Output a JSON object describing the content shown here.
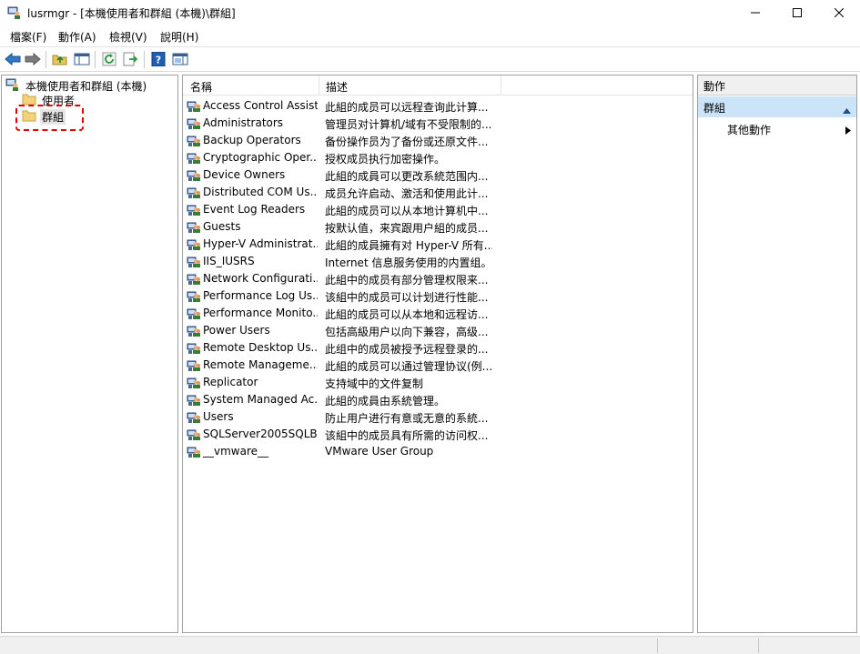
{
  "window": {
    "title": "lusrmgr - [本機使用者和群組 (本機)\\群組]",
    "icon": "computer-users-icon"
  },
  "menu": [
    "檔案(F)",
    "動作(A)",
    "檢視(V)",
    "說明(H)"
  ],
  "toolbar": {
    "buttons": [
      "back-arrow-icon",
      "forward-arrow-icon",
      "up-folder-icon",
      "show-hide-tree-icon",
      "refresh-icon",
      "export-list-icon",
      "help-icon",
      "action-pane-icon"
    ]
  },
  "tree": {
    "root": "本機使用者和群組 (本機)",
    "users": "使用者",
    "groups": "群組"
  },
  "list": {
    "columns": [
      "名稱",
      "描述"
    ],
    "rows": [
      {
        "name": "Access Control Assist...",
        "desc": "此組的成员可以远程查询此计算..."
      },
      {
        "name": "Administrators",
        "desc": "管理员对计算机/域有不受限制的..."
      },
      {
        "name": "Backup Operators",
        "desc": "备份操作员为了备份或还原文件..."
      },
      {
        "name": "Cryptographic Oper...",
        "desc": "授权成员执行加密操作。"
      },
      {
        "name": "Device Owners",
        "desc": "此組的成員可以更改系統范围内..."
      },
      {
        "name": "Distributed COM Us...",
        "desc": "成员允许启动、激活和使用此计..."
      },
      {
        "name": "Event Log Readers",
        "desc": "此組的成员可以从本地计算机中..."
      },
      {
        "name": "Guests",
        "desc": "按默认值，来宾跟用户組的成员..."
      },
      {
        "name": "Hyper-V Administrat...",
        "desc": "此組的成員擁有对 Hyper-V 所有..."
      },
      {
        "name": "IIS_IUSRS",
        "desc": "Internet 信息服务使用的内置组。"
      },
      {
        "name": "Network Configurati...",
        "desc": "此組中的成员有部分管理权限来..."
      },
      {
        "name": "Performance Log Us...",
        "desc": "该組中的成员可以计划进行性能..."
      },
      {
        "name": "Performance Monito...",
        "desc": "此組的成员可以从本地和远程访..."
      },
      {
        "name": "Power Users",
        "desc": "包括高級用户以向下兼容，高级..."
      },
      {
        "name": "Remote Desktop Us...",
        "desc": "此组中的成员被授予远程登录的..."
      },
      {
        "name": "Remote Manageme...",
        "desc": "此組的成员可以通过管理协议(例..."
      },
      {
        "name": "Replicator",
        "desc": "支持域中的文件复制"
      },
      {
        "name": "System Managed Ac...",
        "desc": "此組的成員由系統管理。"
      },
      {
        "name": "Users",
        "desc": "防止用户进行有意或无意的系統..."
      },
      {
        "name": "SQLServer2005SQLB...",
        "desc": "该組中的成员具有所需的访问权..."
      },
      {
        "name": "__vmware__",
        "desc": "VMware User Group"
      }
    ]
  },
  "actions": {
    "title": "動作",
    "section": "群組",
    "items": [
      "其他動作"
    ]
  },
  "colors": {
    "section_bg": "#cce4f7",
    "highlight": "#e10000"
  }
}
